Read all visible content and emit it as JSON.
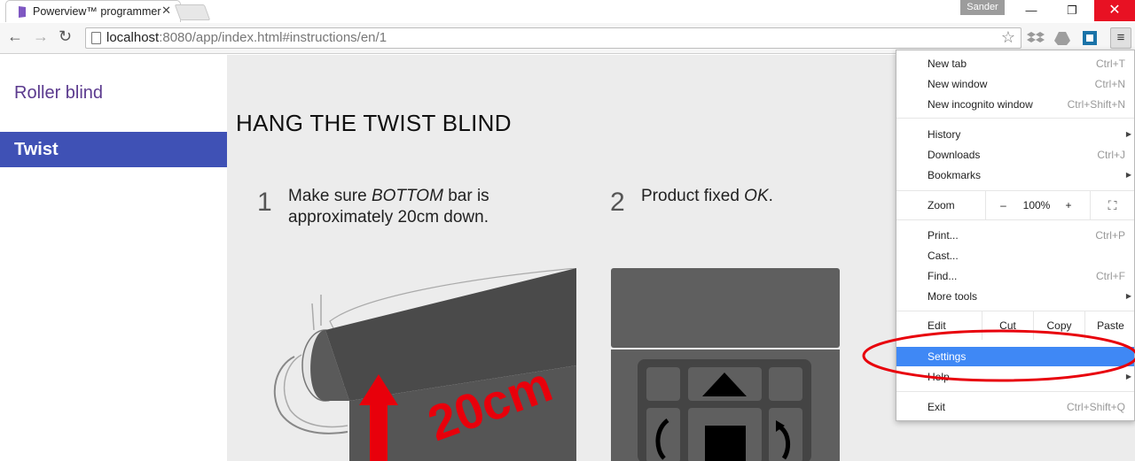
{
  "browser": {
    "tab_title": "Powerview™ programmer",
    "tab_close": "✕",
    "user_name": "Sander",
    "minimize": "—",
    "maximize": "❐",
    "close": "✕",
    "url_host": "localhost",
    "url_rest": ":8080/app/index.html#instructions/en/1",
    "star": "☆",
    "menu_icon": "≡",
    "back": "←",
    "forward": "→",
    "reload": "↻"
  },
  "sidebar": {
    "items": [
      {
        "label": "Roller blind"
      },
      {
        "label": "Twist"
      }
    ]
  },
  "main": {
    "title": "HANG THE TWIST BLIND",
    "steps": [
      {
        "num": "1",
        "text_a": "Make sure ",
        "text_em": "BOTTOM",
        "text_b": " bar is",
        "text_line2": "approximately 20cm down."
      },
      {
        "num": "2",
        "text_a": "Product fixed ",
        "text_em": "OK",
        "text_b": "."
      }
    ],
    "illustration1_label": "20cm"
  },
  "chrome_menu": {
    "new_tab": {
      "label": "New tab",
      "shortcut": "Ctrl+T"
    },
    "new_window": {
      "label": "New window",
      "shortcut": "Ctrl+N"
    },
    "new_incognito": {
      "label": "New incognito window",
      "shortcut": "Ctrl+Shift+N"
    },
    "history": {
      "label": "History",
      "arrow": "▶"
    },
    "downloads": {
      "label": "Downloads",
      "shortcut": "Ctrl+J"
    },
    "bookmarks": {
      "label": "Bookmarks",
      "arrow": "▶"
    },
    "zoom": {
      "label": "Zoom",
      "minus": "–",
      "value": "100%",
      "plus": "+",
      "fullscreen": "⛶"
    },
    "print": {
      "label": "Print...",
      "shortcut": "Ctrl+P"
    },
    "cast": {
      "label": "Cast..."
    },
    "find": {
      "label": "Find...",
      "shortcut": "Ctrl+F"
    },
    "more_tools": {
      "label": "More tools",
      "arrow": "▶"
    },
    "edit": {
      "label": "Edit",
      "cut": "Cut",
      "copy": "Copy",
      "paste": "Paste"
    },
    "settings": {
      "label": "Settings"
    },
    "help": {
      "label": "Help",
      "arrow": "▶"
    },
    "exit": {
      "label": "Exit",
      "shortcut": "Ctrl+Shift+Q"
    }
  },
  "colors": {
    "sidebar_active": "#3f51b5",
    "sidebar_link": "#5b3a8e",
    "menu_highlight": "#3f88f5",
    "annotation_red": "#e8000b"
  }
}
